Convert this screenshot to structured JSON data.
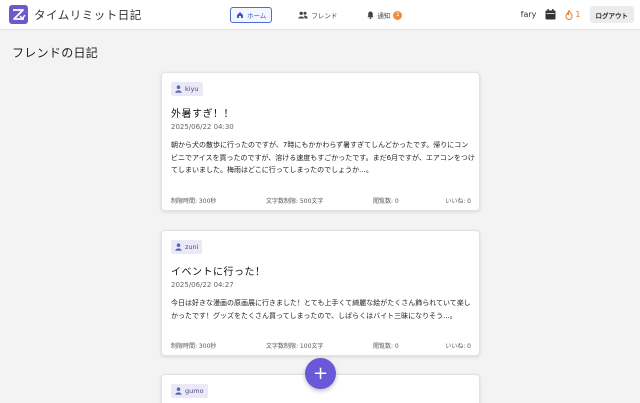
{
  "app": {
    "title": "タイムリミット日記"
  },
  "nav": {
    "home_label": "ホーム",
    "friend_label": "フレンド",
    "notice_label": "通知",
    "notice_count": "1"
  },
  "user": {
    "name": "fary",
    "streak": "1",
    "logout_label": "ログアウト"
  },
  "page": {
    "title": "フレンドの日記"
  },
  "posts": [
    {
      "user": "kiyu",
      "title": "外暑すぎ！！",
      "date": "2025/06/22 04:30",
      "body": "朝から犬の散歩に行ったのですが、7時にもかかわらず暑すぎてしんどかったです。帰りにコンビニでアイスを買ったのですが、溶ける速度もすごかったです。まだ6月ですが、エアコンをつけてしまいました。梅雨はどこに行ってしまったのでしょうか...。",
      "time_limit": "制限時間: 300秒",
      "char_limit": "文字数制限: 500文字",
      "views": "閲覧数: 0",
      "likes": "いいね: 0"
    },
    {
      "user": "zuni",
      "title": "イベントに行った！",
      "date": "2025/06/22 04:27",
      "body": "今日は好きな漫画の原画展に行きました！とても上手くて綺麗な絵がたくさん飾られていて楽しかったです！グッズをたくさん買ってしまったので、しばらくはバイト三昧になりそう...。",
      "time_limit": "制限時間: 300秒",
      "char_limit": "文字数制限: 100文字",
      "views": "閲覧数: 0",
      "likes": "いいね: 0"
    },
    {
      "user": "gumo"
    }
  ],
  "fab": {
    "label": "+"
  },
  "colors": {
    "accent": "#6b58d6",
    "nav_active": "#4b6ed6",
    "badge": "#f08c3c"
  },
  "icons": [
    "app-logo-icon",
    "home-icon",
    "users-icon",
    "bell-icon",
    "calendar-icon",
    "fire-icon",
    "user-icon",
    "plus-icon"
  ]
}
